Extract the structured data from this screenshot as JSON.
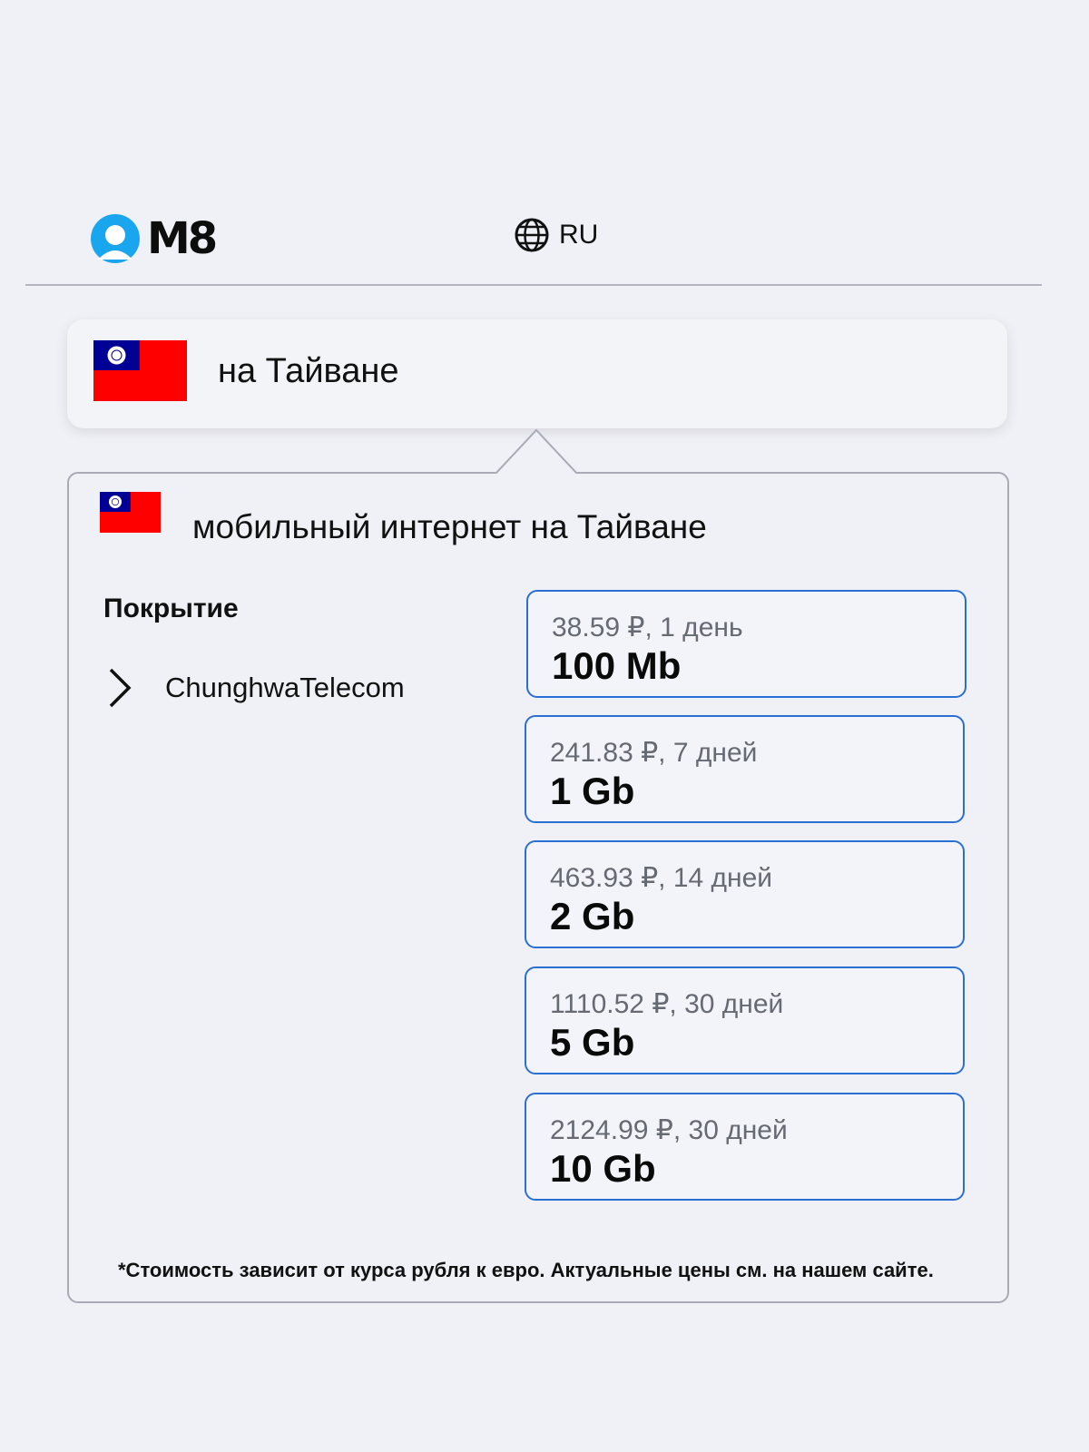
{
  "header": {
    "logo_text": "M8",
    "language": {
      "label": "RU",
      "icon": "globe-icon"
    }
  },
  "search": {
    "flag": "taiwan-flag",
    "value": "на Тайване"
  },
  "panel": {
    "flag": "taiwan-flag",
    "title": "мобильный интернет на Тайване",
    "coverage_title": "Покрытие",
    "operator": {
      "name": "ChunghwaTelecom",
      "icon": "chevron-right-icon"
    },
    "plans": [
      {
        "price": "38.59 ₽, 1 день",
        "volume": "100 Mb"
      },
      {
        "price": "241.83 ₽, 7 дней",
        "volume": "1 Gb"
      },
      {
        "price": "463.93 ₽, 14 дней",
        "volume": "2 Gb"
      },
      {
        "price": "1110.52 ₽, 30 дней",
        "volume": "5 Gb"
      },
      {
        "price": "2124.99 ₽, 30 дней",
        "volume": "10 Gb"
      }
    ],
    "footnote": "*Стоимость зависит от курса рубля к евро. Актуальные цены см. на нашем сайте."
  },
  "colors": {
    "accent": "#2a6fd1",
    "logo": "#1aa6ee",
    "flag_red": "#fe0000",
    "flag_blue": "#000095",
    "background": "#f0f1f6"
  }
}
